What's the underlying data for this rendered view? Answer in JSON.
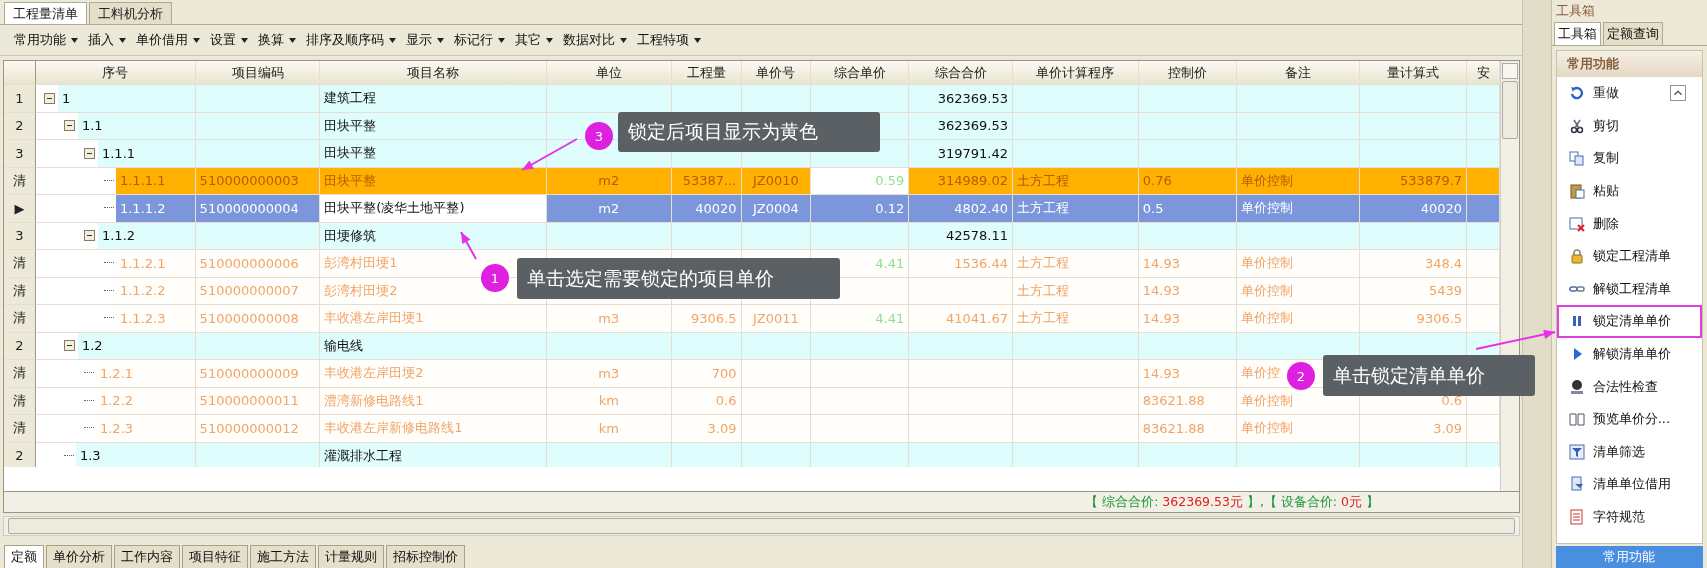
{
  "top_tabs": [
    {
      "label": "工程量清单",
      "selected": true
    },
    {
      "label": "工料机分析",
      "selected": false
    }
  ],
  "toolbar": [
    "常用功能",
    "插入",
    "单价借用",
    "设置",
    "换算",
    "排序及顺序码",
    "显示",
    "标记行",
    "其它",
    "数据对比",
    "工程特项"
  ],
  "table": {
    "columns": [
      "序号",
      "项目编码",
      "项目名称",
      "单位",
      "工程量",
      "单价号",
      "综合单价",
      "综合合价",
      "单价计算程序",
      "控制价",
      "备注",
      "量计算式",
      "安"
    ],
    "rows": [
      {
        "marker": "1",
        "kind": "group",
        "no": "1",
        "name": "建筑工程",
        "total": "362369.53",
        "children": [
          {
            "marker": "2",
            "kind": "group",
            "no": "1.1",
            "name": "田块平整",
            "total": "362369.53",
            "children": [
              {
                "marker": "3",
                "kind": "group",
                "no": "1.1.1",
                "name": "田块平整",
                "total": "319791.42",
                "children": [
                  {
                    "marker": "清",
                    "kind": "item",
                    "locked": true,
                    "selected": false,
                    "no": "1.1.1.1",
                    "code": "510000000003",
                    "name": "田块平整",
                    "unit": "m2",
                    "qty": "53387...",
                    "price_no": "JZ0010",
                    "unit_price": "0.59",
                    "total": "314989.02",
                    "procedure": "土方工程",
                    "control": "0.76",
                    "note": "单价控制",
                    "formula": "533879.7"
                  },
                  {
                    "marker": "▶",
                    "kind": "item",
                    "locked": false,
                    "selected": true,
                    "no": "1.1.1.2",
                    "code": "510000000004",
                    "name": "田块平整(凌华土地平整)",
                    "unit": "m2",
                    "qty": "40020",
                    "price_no": "JZ0004",
                    "unit_price": "0.12",
                    "total": "4802.40",
                    "procedure": "土方工程",
                    "control": "0.5",
                    "note": "单价控制",
                    "formula": "40020"
                  }
                ]
              },
              {
                "marker": "3",
                "kind": "group",
                "no": "1.1.2",
                "name": "田埂修筑",
                "total": "42578.11",
                "children": [
                  {
                    "marker": "清",
                    "kind": "item",
                    "locked": false,
                    "selected": false,
                    "no": "1.1.2.1",
                    "code": "510000000006",
                    "name": "彭湾村田埂1",
                    "unit_price": "4.41",
                    "total": "1536.44",
                    "procedure": "土方工程",
                    "control": "14.93",
                    "note": "单价控制",
                    "formula": "348.4"
                  },
                  {
                    "marker": "清",
                    "kind": "item",
                    "locked": false,
                    "selected": false,
                    "no": "1.1.2.2",
                    "code": "510000000007",
                    "name": "彭湾村田埂2",
                    "procedure": "土方工程",
                    "control": "14.93",
                    "note": "单价控制",
                    "formula": "5439"
                  },
                  {
                    "marker": "清",
                    "kind": "item",
                    "locked": false,
                    "selected": false,
                    "no": "1.1.2.3",
                    "code": "510000000008",
                    "name": "丰收港左岸田埂1",
                    "unit": "m3",
                    "qty": "9306.5",
                    "price_no": "JZ0011",
                    "unit_price": "4.41",
                    "total": "41041.67",
                    "procedure": "土方工程",
                    "control": "14.93",
                    "note": "单价控制",
                    "formula": "9306.5"
                  }
                ]
              }
            ]
          },
          {
            "marker": "2",
            "kind": "group",
            "no": "1.2",
            "name": "输电线",
            "children": [
              {
                "marker": "清",
                "kind": "item",
                "locked": false,
                "selected": false,
                "no": "1.2.1",
                "code": "510000000009",
                "name": "丰收港左岸田埂2",
                "unit": "m3",
                "qty": "700",
                "control": "14.93",
                "note": "单价控"
              },
              {
                "marker": "清",
                "kind": "item",
                "locked": false,
                "selected": false,
                "no": "1.2.2",
                "code": "510000000011",
                "name": "澧湾新修电路线1",
                "unit": "km",
                "qty": "0.6",
                "control": "83621.88",
                "note": "单价控制",
                "formula": "0.6"
              },
              {
                "marker": "清",
                "kind": "item",
                "locked": false,
                "selected": false,
                "no": "1.2.3",
                "code": "510000000012",
                "name": "丰收港左岸新修电路线1",
                "unit": "km",
                "qty": "3.09",
                "control": "83621.88",
                "note": "单价控制",
                "formula": "3.09"
              }
            ]
          },
          {
            "marker": "2",
            "kind": "group",
            "no": "1.3",
            "name": "灌溉排水工程"
          }
        ]
      }
    ]
  },
  "status_bar": [
    {
      "kind": "label",
      "text": "【 综合合价: "
    },
    {
      "kind": "value",
      "text": "362369.53元"
    },
    {
      "kind": "label",
      "text": " 】,【 设备合价: "
    },
    {
      "kind": "value",
      "text": "0元"
    },
    {
      "kind": "label",
      "text": " 】"
    }
  ],
  "bottom_tabs": [
    {
      "label": "定额",
      "selected": true
    },
    {
      "label": "单价分析",
      "selected": false
    },
    {
      "label": "工作内容",
      "selected": false
    },
    {
      "label": "项目特征",
      "selected": false
    },
    {
      "label": "施工方法",
      "selected": false
    },
    {
      "label": "计量规则",
      "selected": false
    },
    {
      "label": "招标控制价",
      "selected": false
    }
  ],
  "toolbox": {
    "title": "工具箱",
    "tabs": [
      {
        "label": "工具箱",
        "selected": true
      },
      {
        "label": "定额查询",
        "selected": false
      }
    ],
    "section": "常用功能",
    "items": [
      {
        "label": "重做",
        "highlighted": false
      },
      {
        "label": "剪切",
        "highlighted": false
      },
      {
        "label": "复制",
        "highlighted": false
      },
      {
        "label": "粘贴",
        "highlighted": false
      },
      {
        "label": "删除",
        "highlighted": false
      },
      {
        "label": "锁定工程清单",
        "highlighted": false
      },
      {
        "label": "解锁工程清单",
        "highlighted": false
      },
      {
        "label": "锁定清单单价",
        "highlighted": true
      },
      {
        "label": "解锁清单单价",
        "highlighted": false
      },
      {
        "label": "合法性检查",
        "highlighted": false
      },
      {
        "label": "预览单价分...",
        "highlighted": false
      },
      {
        "label": "清单筛选",
        "highlighted": false
      },
      {
        "label": "清单单位借用",
        "highlighted": false
      },
      {
        "label": "字符规范",
        "highlighted": false
      }
    ],
    "footer": "常用功能"
  },
  "callouts": [
    {
      "number": "3",
      "text": "锁定后项目显示为黄色"
    },
    {
      "number": "1",
      "text": "单击选定需要锁定的项目单价"
    },
    {
      "number": "2",
      "text": "单击锁定清单单价"
    }
  ]
}
